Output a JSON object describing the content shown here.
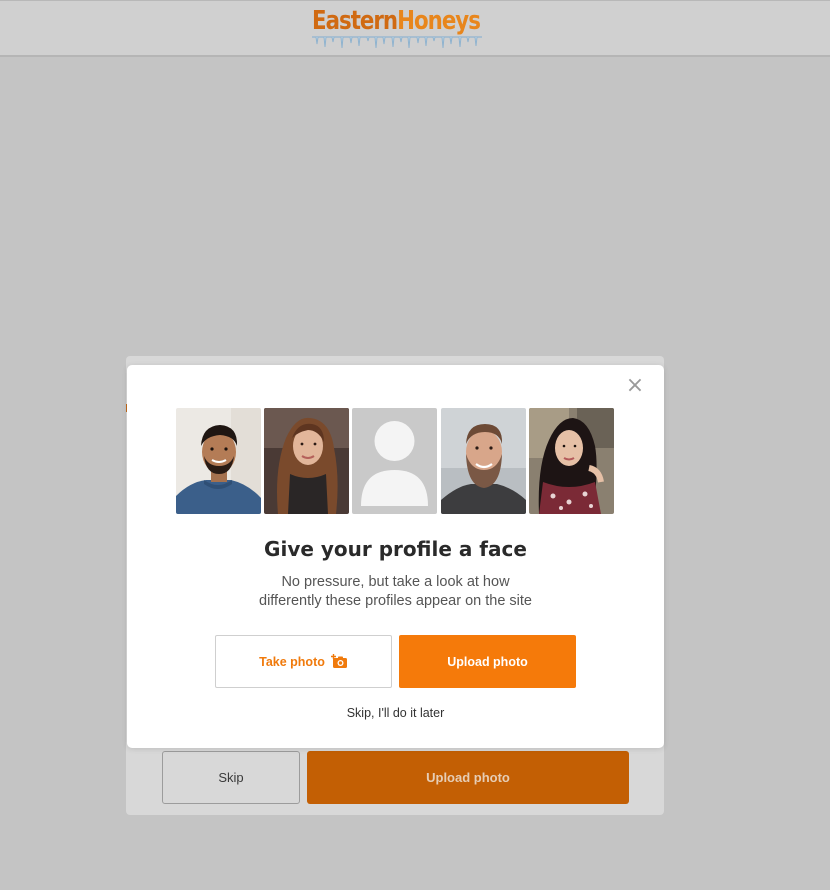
{
  "header": {
    "logo": {
      "part1": "Eastern",
      "part2": "Honeys",
      "color1": "#d06a12",
      "color2": "#e8861c"
    }
  },
  "background_card": {
    "skip_label": "Skip",
    "upload_label": "Upload photo",
    "upload_color": "#c35f04"
  },
  "modal": {
    "close_label": "×",
    "title": "Give your profile a face",
    "subtitle_line1": "No pressure, but take a look at how",
    "subtitle_line2": "differently these profiles appear on the site",
    "take_photo_label": "Take photo",
    "upload_photo_label": "Upload photo",
    "skip_label": "Skip, I'll do it later",
    "accent_color": "#f57a0a",
    "photos": [
      {
        "name": "profile-photo-man-blue-shirt"
      },
      {
        "name": "profile-photo-woman-long-hair"
      },
      {
        "name": "profile-photo-placeholder"
      },
      {
        "name": "profile-photo-bearded-man"
      },
      {
        "name": "profile-photo-woman-floral-top"
      }
    ]
  },
  "icons": {
    "close": "close-icon",
    "camera": "camera-plus-icon",
    "avatar": "avatar-placeholder-icon"
  }
}
